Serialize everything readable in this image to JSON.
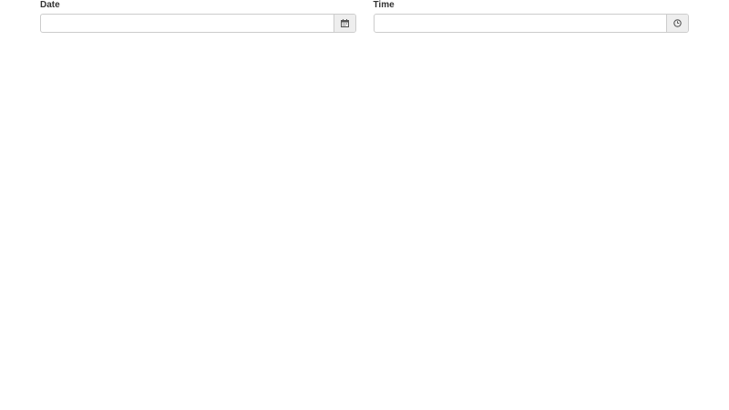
{
  "form": {
    "date": {
      "label": "Date",
      "value": "",
      "placeholder": "",
      "icon": "calendar-icon"
    },
    "time": {
      "label": "Time",
      "value": "",
      "placeholder": "",
      "icon": "clock-icon"
    }
  }
}
